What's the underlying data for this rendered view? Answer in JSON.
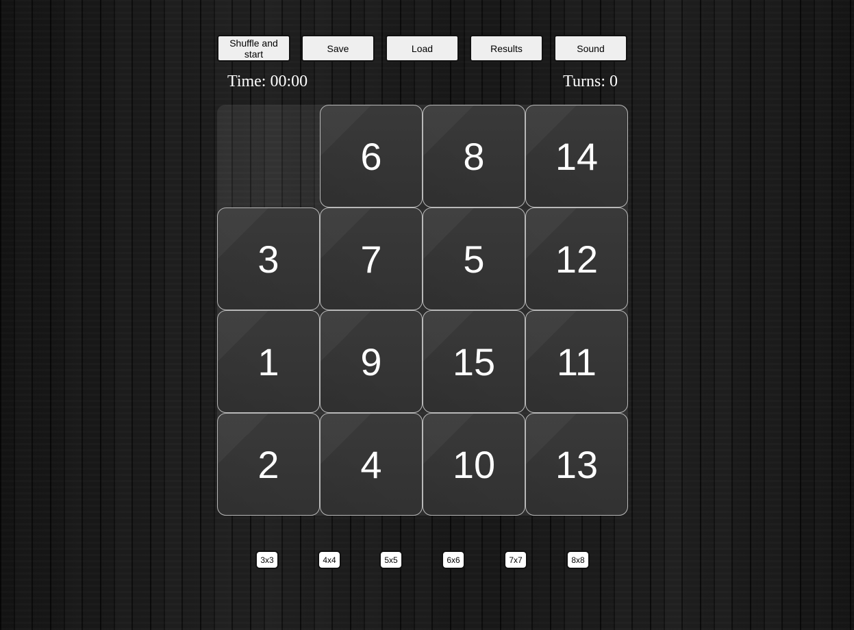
{
  "toolbar": {
    "buttons": [
      "Shuffle and start",
      "Save",
      "Load",
      "Results",
      "Sound"
    ]
  },
  "status": {
    "time": "Time: 00:00",
    "turns": "Turns: 0"
  },
  "board": {
    "rows": 4,
    "cols": 4,
    "tiles": [
      [
        null,
        "6",
        "8",
        "14"
      ],
      [
        "3",
        "7",
        "5",
        "12"
      ],
      [
        "1",
        "9",
        "15",
        "11"
      ],
      [
        "2",
        "4",
        "10",
        "13"
      ]
    ]
  },
  "sizes": [
    "3x3",
    "4x4",
    "5x5",
    "6x6",
    "7x7",
    "8x8"
  ]
}
